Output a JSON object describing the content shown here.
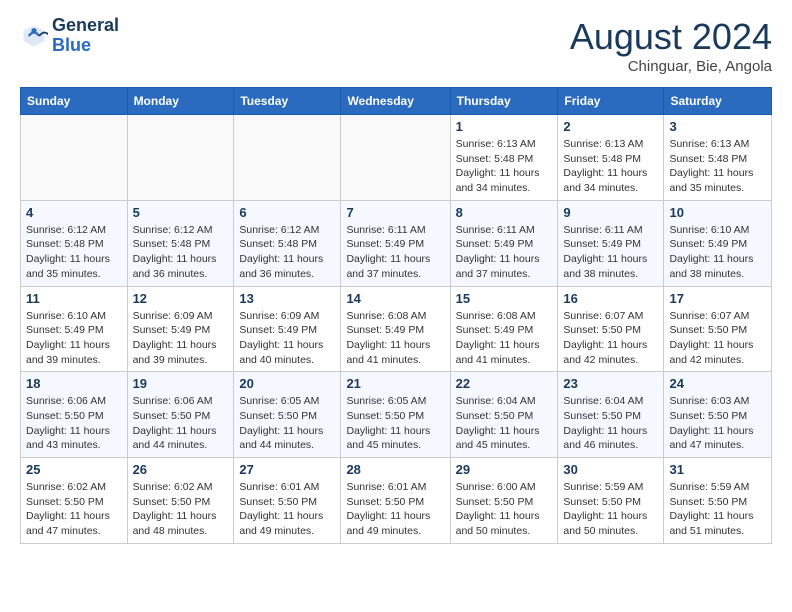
{
  "header": {
    "logo_line1": "General",
    "logo_line2": "Blue",
    "month": "August 2024",
    "location": "Chinguar, Bie, Angola"
  },
  "weekdays": [
    "Sunday",
    "Monday",
    "Tuesday",
    "Wednesday",
    "Thursday",
    "Friday",
    "Saturday"
  ],
  "weeks": [
    [
      {
        "day": "",
        "info": ""
      },
      {
        "day": "",
        "info": ""
      },
      {
        "day": "",
        "info": ""
      },
      {
        "day": "",
        "info": ""
      },
      {
        "day": "1",
        "info": "Sunrise: 6:13 AM\nSunset: 5:48 PM\nDaylight: 11 hours\nand 34 minutes."
      },
      {
        "day": "2",
        "info": "Sunrise: 6:13 AM\nSunset: 5:48 PM\nDaylight: 11 hours\nand 34 minutes."
      },
      {
        "day": "3",
        "info": "Sunrise: 6:13 AM\nSunset: 5:48 PM\nDaylight: 11 hours\nand 35 minutes."
      }
    ],
    [
      {
        "day": "4",
        "info": "Sunrise: 6:12 AM\nSunset: 5:48 PM\nDaylight: 11 hours\nand 35 minutes."
      },
      {
        "day": "5",
        "info": "Sunrise: 6:12 AM\nSunset: 5:48 PM\nDaylight: 11 hours\nand 36 minutes."
      },
      {
        "day": "6",
        "info": "Sunrise: 6:12 AM\nSunset: 5:48 PM\nDaylight: 11 hours\nand 36 minutes."
      },
      {
        "day": "7",
        "info": "Sunrise: 6:11 AM\nSunset: 5:49 PM\nDaylight: 11 hours\nand 37 minutes."
      },
      {
        "day": "8",
        "info": "Sunrise: 6:11 AM\nSunset: 5:49 PM\nDaylight: 11 hours\nand 37 minutes."
      },
      {
        "day": "9",
        "info": "Sunrise: 6:11 AM\nSunset: 5:49 PM\nDaylight: 11 hours\nand 38 minutes."
      },
      {
        "day": "10",
        "info": "Sunrise: 6:10 AM\nSunset: 5:49 PM\nDaylight: 11 hours\nand 38 minutes."
      }
    ],
    [
      {
        "day": "11",
        "info": "Sunrise: 6:10 AM\nSunset: 5:49 PM\nDaylight: 11 hours\nand 39 minutes."
      },
      {
        "day": "12",
        "info": "Sunrise: 6:09 AM\nSunset: 5:49 PM\nDaylight: 11 hours\nand 39 minutes."
      },
      {
        "day": "13",
        "info": "Sunrise: 6:09 AM\nSunset: 5:49 PM\nDaylight: 11 hours\nand 40 minutes."
      },
      {
        "day": "14",
        "info": "Sunrise: 6:08 AM\nSunset: 5:49 PM\nDaylight: 11 hours\nand 41 minutes."
      },
      {
        "day": "15",
        "info": "Sunrise: 6:08 AM\nSunset: 5:49 PM\nDaylight: 11 hours\nand 41 minutes."
      },
      {
        "day": "16",
        "info": "Sunrise: 6:07 AM\nSunset: 5:50 PM\nDaylight: 11 hours\nand 42 minutes."
      },
      {
        "day": "17",
        "info": "Sunrise: 6:07 AM\nSunset: 5:50 PM\nDaylight: 11 hours\nand 42 minutes."
      }
    ],
    [
      {
        "day": "18",
        "info": "Sunrise: 6:06 AM\nSunset: 5:50 PM\nDaylight: 11 hours\nand 43 minutes."
      },
      {
        "day": "19",
        "info": "Sunrise: 6:06 AM\nSunset: 5:50 PM\nDaylight: 11 hours\nand 44 minutes."
      },
      {
        "day": "20",
        "info": "Sunrise: 6:05 AM\nSunset: 5:50 PM\nDaylight: 11 hours\nand 44 minutes."
      },
      {
        "day": "21",
        "info": "Sunrise: 6:05 AM\nSunset: 5:50 PM\nDaylight: 11 hours\nand 45 minutes."
      },
      {
        "day": "22",
        "info": "Sunrise: 6:04 AM\nSunset: 5:50 PM\nDaylight: 11 hours\nand 45 minutes."
      },
      {
        "day": "23",
        "info": "Sunrise: 6:04 AM\nSunset: 5:50 PM\nDaylight: 11 hours\nand 46 minutes."
      },
      {
        "day": "24",
        "info": "Sunrise: 6:03 AM\nSunset: 5:50 PM\nDaylight: 11 hours\nand 47 minutes."
      }
    ],
    [
      {
        "day": "25",
        "info": "Sunrise: 6:02 AM\nSunset: 5:50 PM\nDaylight: 11 hours\nand 47 minutes."
      },
      {
        "day": "26",
        "info": "Sunrise: 6:02 AM\nSunset: 5:50 PM\nDaylight: 11 hours\nand 48 minutes."
      },
      {
        "day": "27",
        "info": "Sunrise: 6:01 AM\nSunset: 5:50 PM\nDaylight: 11 hours\nand 49 minutes."
      },
      {
        "day": "28",
        "info": "Sunrise: 6:01 AM\nSunset: 5:50 PM\nDaylight: 11 hours\nand 49 minutes."
      },
      {
        "day": "29",
        "info": "Sunrise: 6:00 AM\nSunset: 5:50 PM\nDaylight: 11 hours\nand 50 minutes."
      },
      {
        "day": "30",
        "info": "Sunrise: 5:59 AM\nSunset: 5:50 PM\nDaylight: 11 hours\nand 50 minutes."
      },
      {
        "day": "31",
        "info": "Sunrise: 5:59 AM\nSunset: 5:50 PM\nDaylight: 11 hours\nand 51 minutes."
      }
    ]
  ]
}
